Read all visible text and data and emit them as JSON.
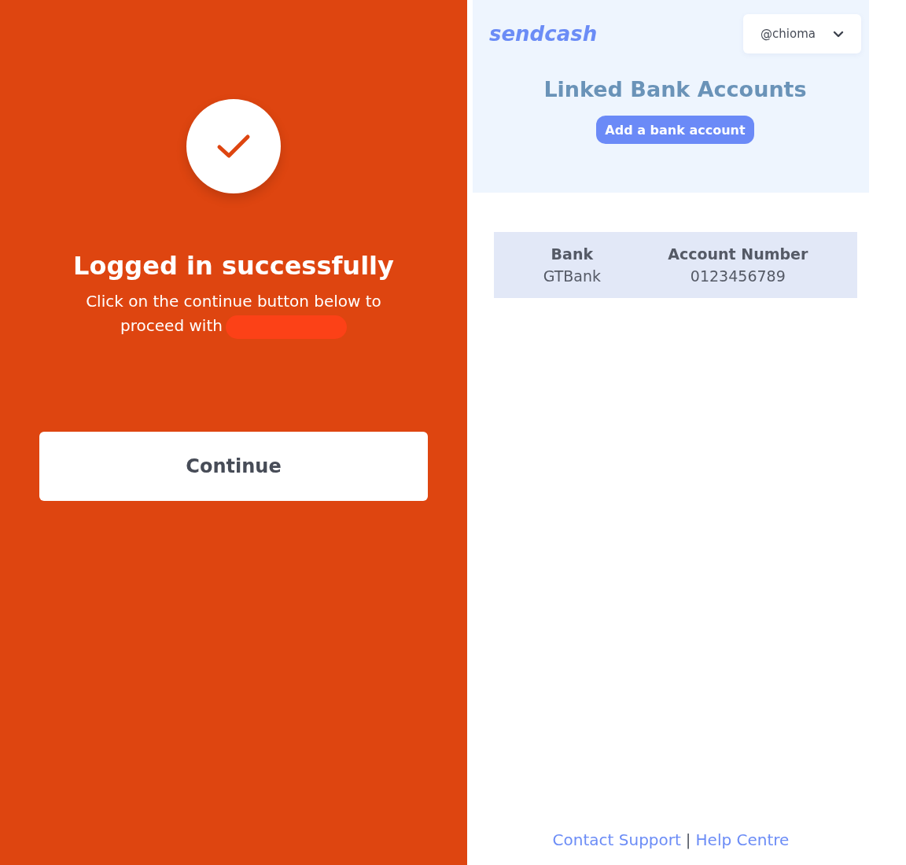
{
  "success_panel": {
    "title": "Logged in successfully",
    "message": "Click on the continue button below to proceed with",
    "continue_button": "Continue"
  },
  "header": {
    "logo": "sendcash",
    "user_menu": "@chioma"
  },
  "linked_accounts": {
    "title": "Linked Bank Accounts",
    "add_button": "Add a bank account",
    "columns": [
      "Bank",
      "Account Number"
    ],
    "rows": [
      [
        "GTBank",
        "0123456789"
      ]
    ]
  },
  "footer": {
    "links": [
      "Contact Support",
      "Help Centre"
    ],
    "separator": "|"
  }
}
